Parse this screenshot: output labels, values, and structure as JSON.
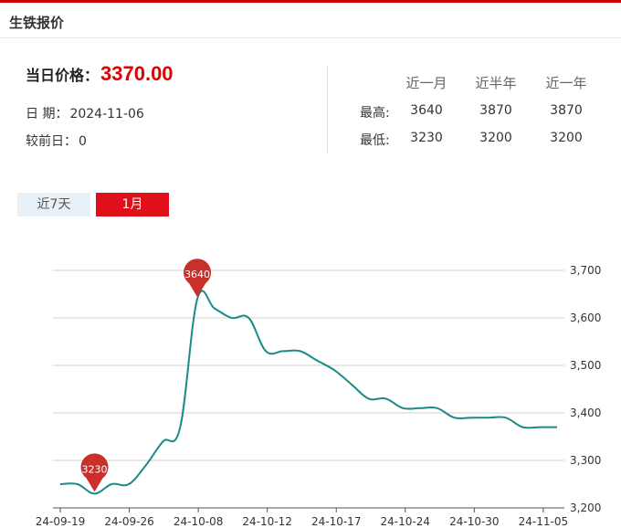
{
  "header": {
    "title": "生铁报价"
  },
  "price": {
    "label": "当日价格：",
    "value": "3370.00"
  },
  "info": {
    "date_label": "日  期：",
    "date_value": "2024-11-06",
    "change_label": "较前日：",
    "change_value": "0"
  },
  "stats": {
    "columns": [
      "近一月",
      "近半年",
      "近一年"
    ],
    "rows": [
      {
        "label": "最高:",
        "values": [
          "3640",
          "3870",
          "3870"
        ]
      },
      {
        "label": "最低:",
        "values": [
          "3230",
          "3200",
          "3200"
        ]
      }
    ]
  },
  "tabs": {
    "tab_7d": "近7天",
    "tab_1m": "1月",
    "active": "1月"
  },
  "chart_data": {
    "type": "line",
    "title": "",
    "xlabel": "",
    "ylabel": "",
    "ylim": [
      3200,
      3700
    ],
    "y_ticks": [
      "3,200",
      "3,300",
      "3,400",
      "3,500",
      "3,600",
      "3,700"
    ],
    "grid": true,
    "line_color": "#1a8a8a",
    "marker_color": "#c9302c",
    "x_tick_labels": [
      "24-09-19",
      "24-09-26",
      "24-10-08",
      "24-10-12",
      "24-10-17",
      "24-10-24",
      "24-10-30",
      "24-11-05"
    ],
    "series": [
      {
        "values": [
          3250,
          3250,
          3230,
          3250,
          3250,
          3290,
          3340,
          3370,
          3640,
          3620,
          3600,
          3600,
          3530,
          3530,
          3530,
          3510,
          3490,
          3460,
          3430,
          3430,
          3410,
          3410,
          3410,
          3390,
          3390,
          3390,
          3390,
          3370,
          3370,
          3370
        ]
      }
    ],
    "annotations": [
      {
        "label": "3640",
        "value": 3640,
        "index": 8
      },
      {
        "label": "3230",
        "value": 3230,
        "index": 2
      }
    ]
  }
}
